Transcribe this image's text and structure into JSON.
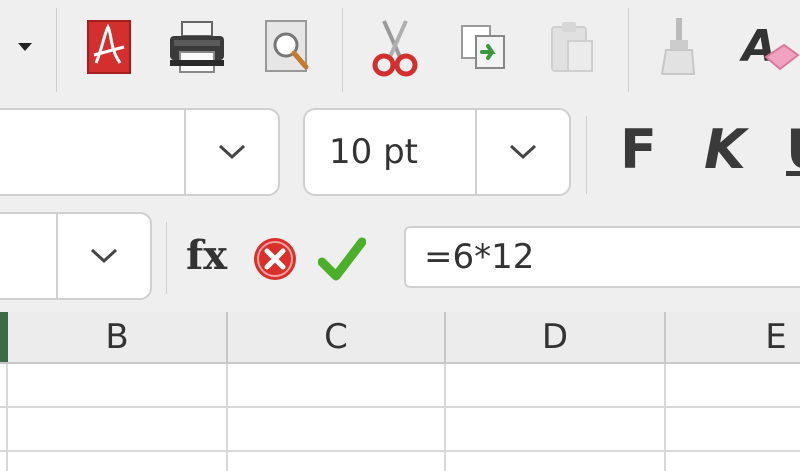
{
  "toolbar": {
    "buttons": [
      {
        "name": "dropdown-arrow",
        "icon": "triangle-down-icon"
      },
      {
        "name": "export-pdf",
        "icon": "pdf-icon"
      },
      {
        "name": "print",
        "icon": "printer-icon"
      },
      {
        "name": "print-preview",
        "icon": "magnifier-page-icon"
      },
      {
        "name": "cut",
        "icon": "scissors-icon"
      },
      {
        "name": "copy",
        "icon": "copy-icon"
      },
      {
        "name": "paste",
        "icon": "paste-icon"
      },
      {
        "name": "clone-formatting",
        "icon": "paintbrush-icon"
      },
      {
        "name": "clear-formatting",
        "icon": "eraser-icon"
      }
    ]
  },
  "format_bar": {
    "font_name": "",
    "font_size": "10 pt",
    "bold_label": "F",
    "italic_label": "K",
    "underline_label": "U"
  },
  "formula_bar": {
    "name_box": "",
    "fx_label": "fx",
    "formula": "=6*12"
  },
  "sheet": {
    "columns": [
      "B",
      "C",
      "D",
      "E"
    ]
  },
  "colors": {
    "accept": "#4caf2a",
    "cancel": "#d9302c",
    "pdf": "#d32f2f",
    "selected_column_marker": "#3d6b47"
  }
}
